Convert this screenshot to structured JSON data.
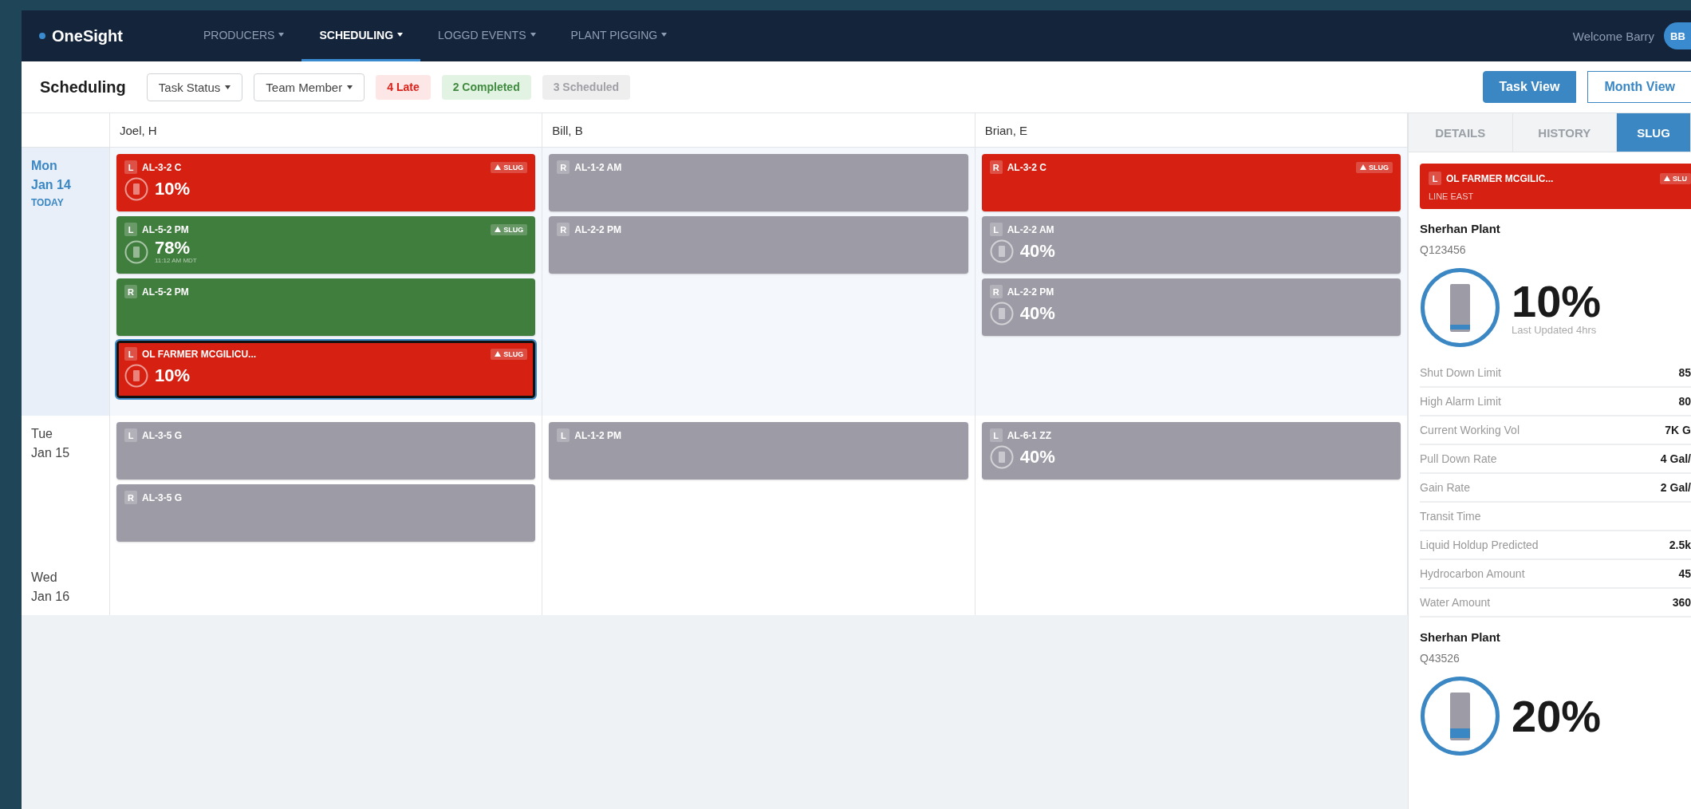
{
  "nav": {
    "brand": "OneSight",
    "items": [
      {
        "label": "PRODUCERS",
        "selected": false
      },
      {
        "label": "SCHEDULING",
        "selected": true
      },
      {
        "label": "LOGGD EVENTS",
        "selected": false
      },
      {
        "label": "PLANT PIGGING",
        "selected": false
      }
    ],
    "welcome": "Welcome Barry",
    "avatar": "BB"
  },
  "toolbar": {
    "title": "Scheduling",
    "filters": [
      "Task Status",
      "Team Member"
    ],
    "badges": [
      {
        "label": "4 Late",
        "kind": "late"
      },
      {
        "label": "2 Completed",
        "kind": "completed"
      },
      {
        "label": "3 Scheduled",
        "kind": "scheduled"
      }
    ],
    "views": [
      {
        "label": "Task View",
        "selected": true
      },
      {
        "label": "Month View",
        "selected": false
      }
    ]
  },
  "calendar": {
    "columns": [
      "Joel, H",
      "Bill, B",
      "Brian, E"
    ],
    "days": [
      {
        "weekday": "Mon",
        "date": "Jan 14",
        "today_label": "TODAY",
        "highlighted": true,
        "cells": [
          [
            {
              "side": "L",
              "title": "AL-3-2 C",
              "kind": "late",
              "badge": "SLUG",
              "percent": "10%",
              "selected": false
            },
            {
              "side": "L",
              "title": "AL-5-2 PM",
              "kind": "completed",
              "badge": "SLUG",
              "percent": "78%",
              "time": "11:12 AM MDT",
              "selected": false
            },
            {
              "side": "R",
              "title": "AL-5-2 PM",
              "kind": "completed",
              "selected": false
            },
            {
              "side": "L",
              "title": "OL FARMER MCGILICU...",
              "kind": "late",
              "badge": "SLUG",
              "percent": "10%",
              "selected": true
            }
          ],
          [
            {
              "side": "R",
              "title": "AL-1-2 AM",
              "kind": "scheduled",
              "selected": false
            },
            {
              "side": "R",
              "title": "AL-2-2 PM",
              "kind": "scheduled",
              "selected": false
            }
          ],
          [
            {
              "side": "R",
              "title": "AL-3-2 C",
              "kind": "late",
              "badge": "SLUG",
              "selected": false
            },
            {
              "side": "L",
              "title": "AL-2-2 AM",
              "kind": "scheduled",
              "percent": "40%",
              "selected": false
            },
            {
              "side": "R",
              "title": "AL-2-2 PM",
              "kind": "scheduled",
              "percent": "40%",
              "selected": false
            }
          ]
        ]
      },
      {
        "weekday": "Tue",
        "date": "Jan 15",
        "highlighted": false,
        "cells": [
          [
            {
              "side": "L",
              "title": "AL-3-5 G",
              "kind": "scheduled",
              "selected": false
            },
            {
              "side": "R",
              "title": "AL-3-5 G",
              "kind": "scheduled",
              "selected": false
            }
          ],
          [
            {
              "side": "L",
              "title": "AL-1-2 PM",
              "kind": "scheduled",
              "selected": false
            }
          ],
          [
            {
              "side": "L",
              "title": "AL-6-1 ZZ",
              "kind": "scheduled",
              "percent": "40%",
              "selected": false
            }
          ]
        ]
      },
      {
        "weekday": "Wed",
        "date": "Jan 16",
        "highlighted": false,
        "cells": [
          [],
          [],
          []
        ]
      }
    ]
  },
  "panel": {
    "tabs": [
      {
        "label": "DETAILS",
        "selected": false
      },
      {
        "label": "HISTORY",
        "selected": false
      },
      {
        "label": "SLUG",
        "selected": true
      }
    ],
    "slug_card": {
      "side": "L",
      "title": "OL FARMER MCGILIC...",
      "badge": "SLU",
      "subtitle": "LINE EAST"
    },
    "wells": [
      {
        "name": "Sherhan Plant",
        "code": "Q123456",
        "percent": "10%",
        "level": 0.1,
        "updated": "Last Updated 4hrs",
        "stats": [
          {
            "label": "Shut Down Limit",
            "value": "85"
          },
          {
            "label": "High Alarm Limit",
            "value": "80"
          },
          {
            "label": "Current Working Vol",
            "value": "7K G"
          },
          {
            "label": "Pull Down Rate",
            "value": "4 Gal/"
          },
          {
            "label": "Gain Rate",
            "value": "2 Gal/"
          },
          {
            "label": "Transit Time"
          },
          {
            "label": "Liquid Holdup Predicted",
            "value": "2.5k"
          },
          {
            "label": "Hydrocarbon Amount",
            "value": "45"
          },
          {
            "label": "Water Amount",
            "value": "360"
          }
        ]
      },
      {
        "name": "Sherhan Plant",
        "code": "Q43526",
        "percent": "20%",
        "level": 0.2
      }
    ]
  }
}
